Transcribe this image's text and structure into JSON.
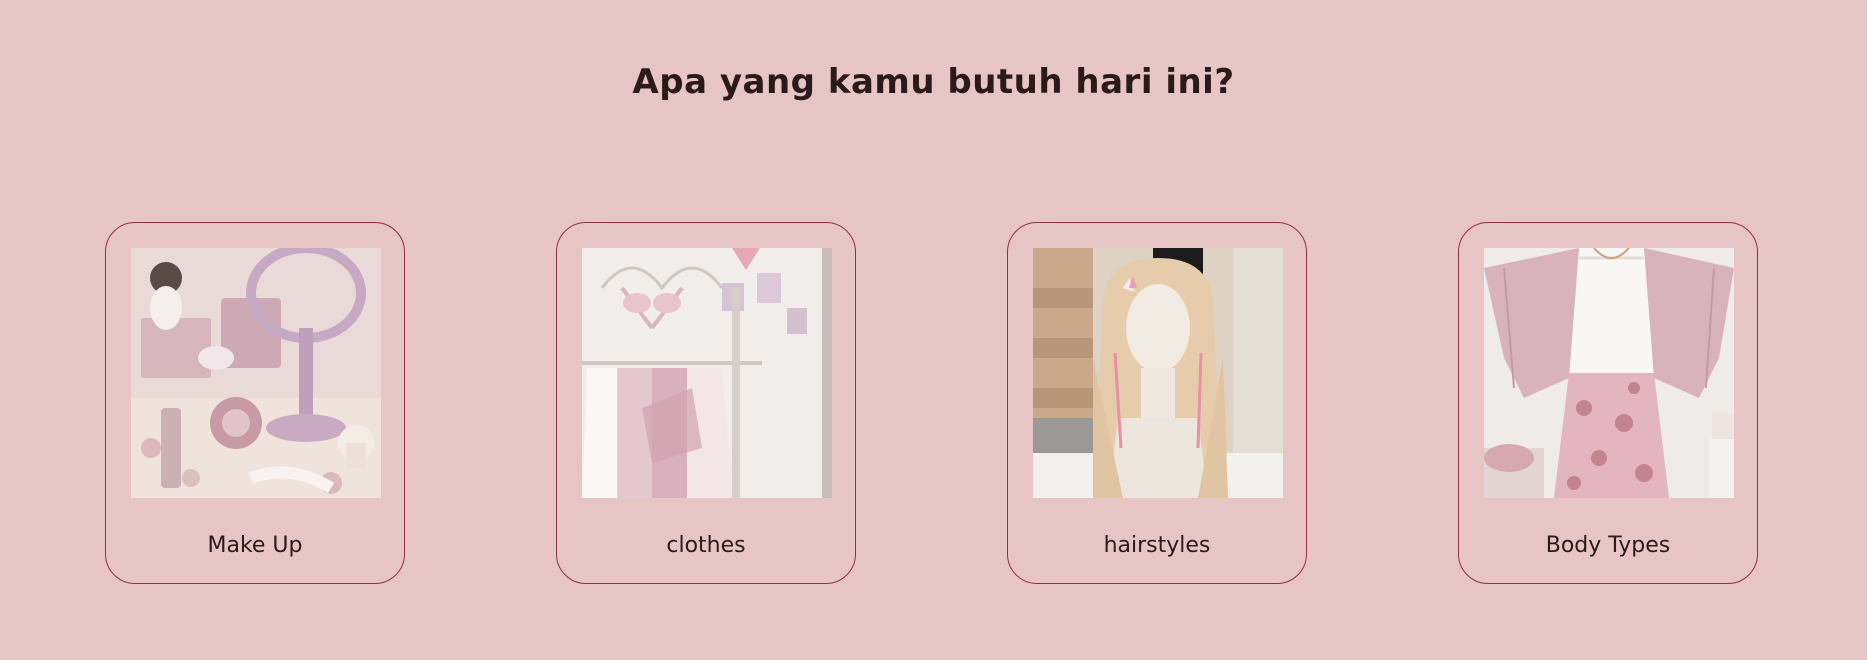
{
  "page": {
    "heading": "Apa yang kamu butuh hari ini?"
  },
  "categories": [
    {
      "label": "Make Up",
      "image": "makeup-vanity-photo"
    },
    {
      "label": "clothes",
      "image": "clothing-rack-photo"
    },
    {
      "label": "hairstyles",
      "image": "wig-on-mannequin-photo"
    },
    {
      "label": "Body Types",
      "image": "cardigan-floral-skirt-outfit-photo"
    }
  ],
  "colors": {
    "background": "#e8c5c5",
    "card_border": "#8c2f45",
    "text": "#2b1a1a"
  }
}
